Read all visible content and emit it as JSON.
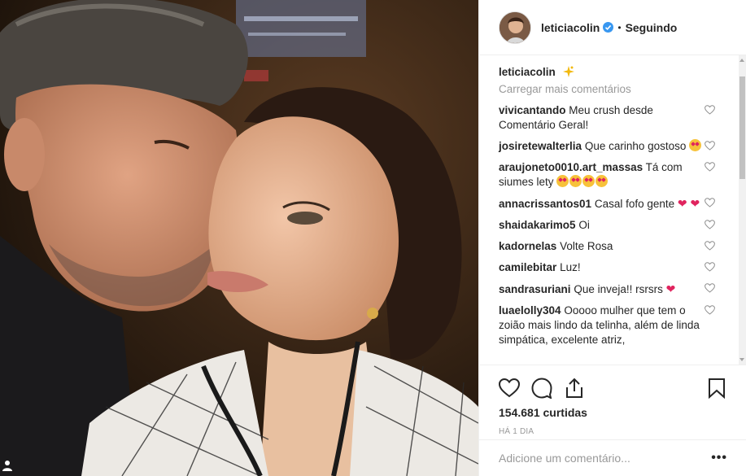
{
  "post": {
    "username": "leticiacolin",
    "follow_status": "Seguindo",
    "separator": "•",
    "caption_user": "leticiacolin",
    "load_more": "Carregar mais comentários",
    "likes": "154.681 curtidas",
    "time": "HÁ 1 DIA"
  },
  "comments": [
    {
      "user": "vivicantando",
      "text": "Meu crush desde Comentário Geral!",
      "emojis": 0,
      "trailing": ""
    },
    {
      "user": "josiretewalterlia",
      "text": "Que carinho gostoso",
      "emojis": 1,
      "trailing": ""
    },
    {
      "user": "araujoneto0010.art_massas",
      "text": "Tá com siumes lety",
      "emojis": 4,
      "trailing": ""
    },
    {
      "user": "annacrissantos01",
      "text": "Casal fofo gente",
      "emojis": 0,
      "trailing": "❤ ❤"
    },
    {
      "user": "shaidakarimo5",
      "text": "Oi",
      "emojis": 0,
      "trailing": ""
    },
    {
      "user": "kadornelas",
      "text": "Volte Rosa",
      "emojis": 0,
      "trailing": ""
    },
    {
      "user": "camilebitar",
      "text": "Luz!",
      "emojis": 0,
      "trailing": ""
    },
    {
      "user": "sandrasuriani",
      "text": "Que inveja!! rsrsrs",
      "emojis": 0,
      "trailing": "❤"
    },
    {
      "user": "luaelolly304",
      "text": "Ooooo mulher que tem o zoião mais lindo da telinha, além de linda simpática, excelente atriz,",
      "emojis": 0,
      "trailing": ""
    }
  ],
  "add_comment": {
    "placeholder": "Adicione um comentário..."
  },
  "more_label": "•••",
  "icons": [
    "heart-icon",
    "comment-icon",
    "share-icon",
    "bookmark-icon",
    "verified-icon",
    "person-tag-icon",
    "sparkle-icon"
  ],
  "colors": {
    "verified": "#3897f0",
    "heart_red": "#e0245e",
    "muted": "#999999",
    "text": "#262626"
  }
}
